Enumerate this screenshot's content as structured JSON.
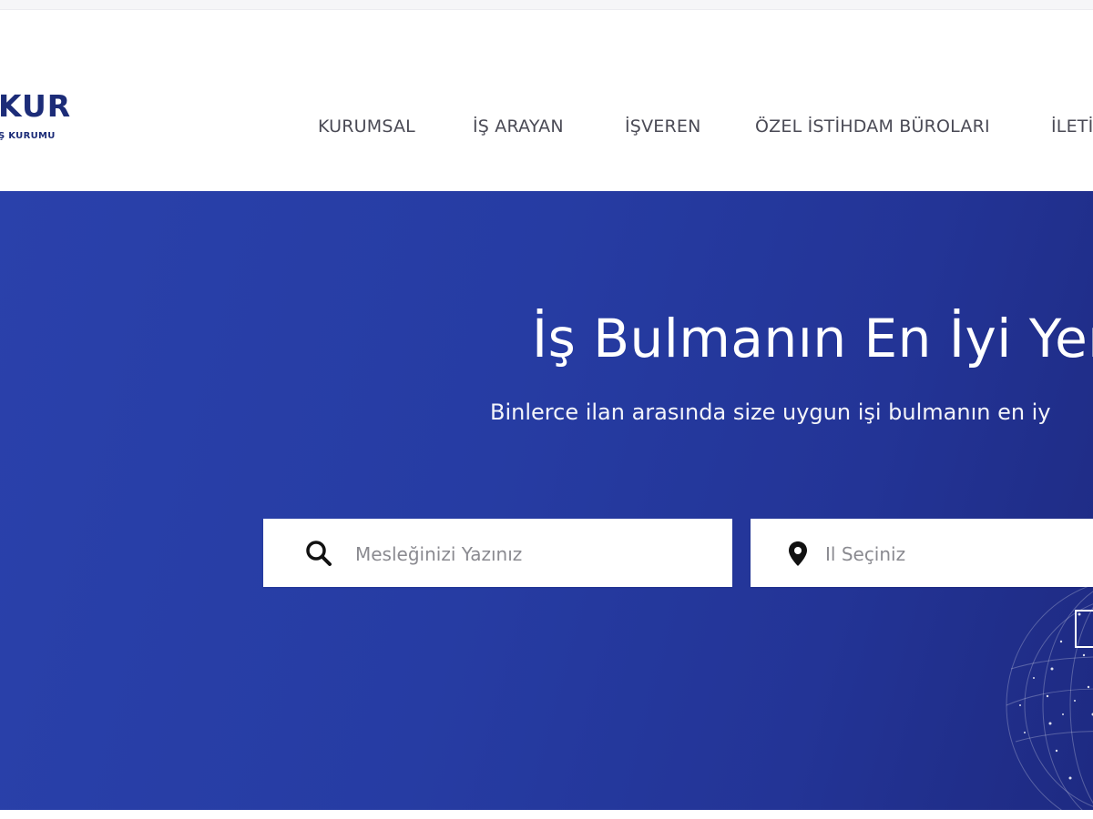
{
  "logo": {
    "main_text": "KUR",
    "sub_text": "Ş KURUMU"
  },
  "nav": {
    "items": [
      {
        "label": "KURUMSAL"
      },
      {
        "label": "İŞ ARAYAN"
      },
      {
        "label": "İŞVEREN"
      },
      {
        "label": "ÖZEL İSTİHDAM BÜROLARI"
      },
      {
        "label": "İLETİ"
      }
    ]
  },
  "hero": {
    "title": "İş Bulmanın En İyi Yer",
    "subtitle": "Binlerce ilan arasında size uygun işi bulmanın en iy"
  },
  "search": {
    "job_placeholder": "Mesleğinizi Yazınız",
    "job_icon": "search-icon",
    "city_placeholder": "Il Seçiniz",
    "city_icon": "map-pin-icon"
  },
  "colors": {
    "brand": "#1c2c78",
    "hero_bg": "#2a41ab",
    "nav_text": "#4a4a55"
  }
}
